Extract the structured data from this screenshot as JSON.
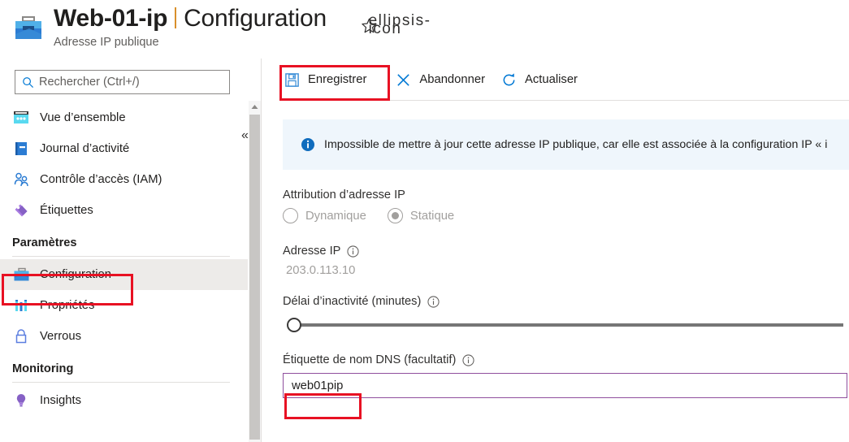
{
  "header": {
    "resource_icon": "public-ip-briefcase-icon",
    "title": "Web-01-ip",
    "section": "Configuration",
    "subtitle": "Adresse IP publique",
    "favorite_icon": "star-icon",
    "more_icon": "ellipsis-icon"
  },
  "sidebar": {
    "search": {
      "placeholder": "Rechercher (Ctrl+/)",
      "icon": "search-icon"
    },
    "collapse_icon": "«",
    "items": [
      {
        "label": "Vue d’ensemble",
        "icon": "overview-icon",
        "selected": false
      },
      {
        "label": "Journal d’activité",
        "icon": "activity-log-icon",
        "selected": false
      },
      {
        "label": "Contrôle d’accès (IAM)",
        "icon": "access-control-icon",
        "selected": false
      },
      {
        "label": "Étiquettes",
        "icon": "tags-icon",
        "selected": false
      }
    ],
    "groups": [
      {
        "label": "Paramètres",
        "items": [
          {
            "label": "Configuration",
            "icon": "configuration-icon",
            "selected": true
          },
          {
            "label": "Propriétés",
            "icon": "properties-icon",
            "selected": false
          },
          {
            "label": "Verrous",
            "icon": "locks-icon",
            "selected": false
          }
        ]
      },
      {
        "label": "Monitoring",
        "items": [
          {
            "label": "Insights",
            "icon": "insights-icon",
            "selected": false
          }
        ]
      }
    ],
    "scrollbar": {
      "up_arrow_icon": "chevron-up-icon"
    }
  },
  "toolbar": {
    "save_label": "Enregistrer",
    "save_icon": "save-floppy-icon",
    "discard_label": "Abandonner",
    "discard_icon": "close-x-icon",
    "refresh_label": "Actualiser",
    "refresh_icon": "refresh-icon"
  },
  "banner": {
    "icon": "info-icon",
    "text": "Impossible de mettre à jour cette adresse IP publique, car elle est associée à la configuration IP « i"
  },
  "form": {
    "assignment": {
      "label": "Attribution d’adresse IP",
      "options": [
        {
          "label": "Dynamique",
          "selected": false
        },
        {
          "label": "Statique",
          "selected": true
        }
      ]
    },
    "ip_address": {
      "label": "Adresse IP",
      "info_icon": "info-circle-icon",
      "value": "203.0.113.10"
    },
    "idle_timeout": {
      "label": "Délai d’inactivité (minutes)",
      "info_icon": "info-circle-icon"
    },
    "dns_label": {
      "label": "Étiquette de nom DNS (facultatif)",
      "info_icon": "info-circle-icon",
      "value": "web01pip"
    }
  },
  "annotations": {
    "accent_color": "#e81123",
    "boxes": [
      {
        "name": "save-button-highlight"
      },
      {
        "name": "configuration-nav-highlight"
      },
      {
        "name": "dns-name-value-highlight"
      }
    ]
  }
}
